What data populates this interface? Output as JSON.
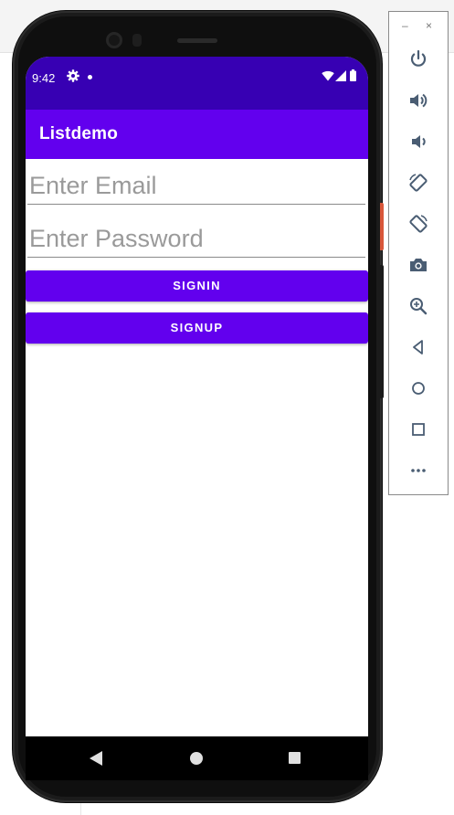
{
  "status_bar": {
    "time": "9:42"
  },
  "app_bar": {
    "title": "Listdemo"
  },
  "form": {
    "email": {
      "value": "",
      "placeholder": "Enter Email"
    },
    "password": {
      "value": "",
      "placeholder": "Enter Password"
    },
    "signin_label": "SIGNIN",
    "signup_label": "SIGNUP"
  },
  "emulator_panel": {
    "minimize_label": "–",
    "close_label": "×",
    "tools": [
      "power-icon",
      "volume-up-icon",
      "volume-down-icon",
      "rotate-left-icon",
      "rotate-right-icon",
      "camera-icon",
      "zoom-icon",
      "back-icon",
      "home-icon",
      "overview-icon",
      "more-icon"
    ]
  },
  "colors": {
    "primary": "#6200EE",
    "primary_dark": "#3700B3",
    "panel_icon": "#4a5d73"
  }
}
